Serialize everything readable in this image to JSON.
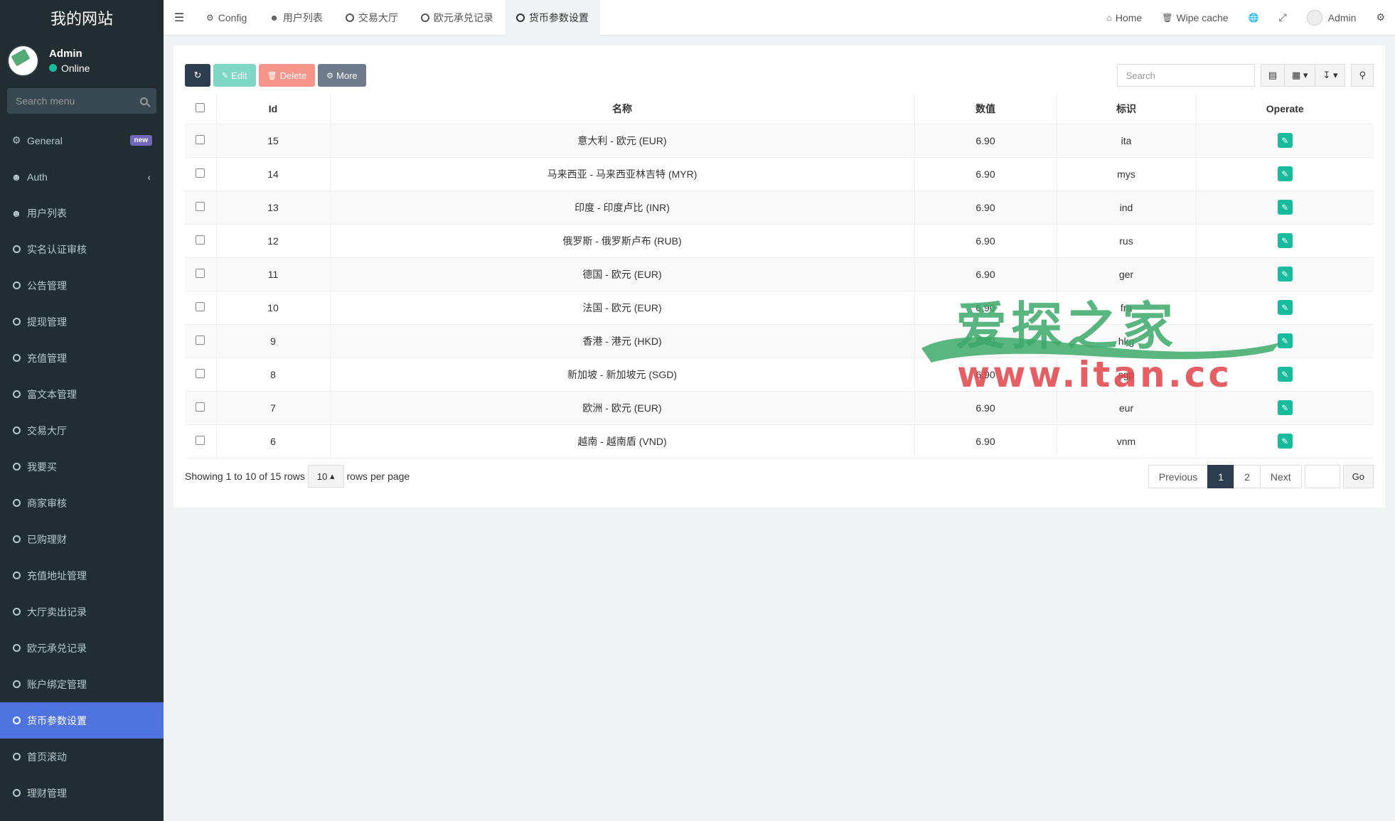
{
  "sidebar": {
    "logo": "我的网站",
    "user": {
      "name": "Admin",
      "status": "Online"
    },
    "search_placeholder": "Search menu",
    "badge_new": "new",
    "items": [
      {
        "label": "General",
        "icon": "cogs-icon"
      },
      {
        "label": "Auth",
        "icon": "users-icon"
      },
      {
        "label": "用户列表",
        "icon": "user-icon"
      },
      {
        "label": "实名认证审核",
        "icon": "circle-icon"
      },
      {
        "label": "公告管理",
        "icon": "circle-icon"
      },
      {
        "label": "提现管理",
        "icon": "circle-icon"
      },
      {
        "label": "充值管理",
        "icon": "circle-icon"
      },
      {
        "label": "富文本管理",
        "icon": "circle-icon"
      },
      {
        "label": "交易大厅",
        "icon": "circle-icon"
      },
      {
        "label": "我要买",
        "icon": "circle-icon"
      },
      {
        "label": "商家审核",
        "icon": "circle-icon"
      },
      {
        "label": "已购理财",
        "icon": "circle-icon"
      },
      {
        "label": "充值地址管理",
        "icon": "circle-icon"
      },
      {
        "label": "大厅卖出记录",
        "icon": "circle-icon"
      },
      {
        "label": "欧元承兑记录",
        "icon": "circle-icon"
      },
      {
        "label": "账户绑定管理",
        "icon": "circle-icon"
      },
      {
        "label": "货币参数设置",
        "icon": "circle-icon",
        "active": true
      },
      {
        "label": "首页滚动",
        "icon": "circle-icon"
      },
      {
        "label": "理财管理",
        "icon": "circle-icon"
      }
    ]
  },
  "topbar": {
    "tabs": [
      {
        "label": "Config",
        "icon": "gear-icon"
      },
      {
        "label": "用户列表",
        "icon": "user-icon"
      },
      {
        "label": "交易大厅",
        "icon": "circle-icon"
      },
      {
        "label": "欧元承兑记录",
        "icon": "circle-icon"
      },
      {
        "label": "货币参数设置",
        "icon": "circle-icon",
        "active": true
      }
    ],
    "home_label": "Home",
    "wipe_label": "Wipe cache",
    "admin_label": "Admin"
  },
  "toolbar": {
    "edit_label": "Edit",
    "delete_label": "Delete",
    "more_label": "More",
    "search_placeholder": "Search"
  },
  "table": {
    "headers": {
      "id": "Id",
      "name": "名称",
      "value": "数值",
      "tag": "标识",
      "operate": "Operate"
    },
    "rows": [
      {
        "id": "15",
        "name": "意大利 - 欧元 (EUR)",
        "value": "6.90",
        "tag": "ita"
      },
      {
        "id": "14",
        "name": "马来西亚 - 马来西亚林吉特 (MYR)",
        "value": "6.90",
        "tag": "mys"
      },
      {
        "id": "13",
        "name": "印度 - 印度卢比 (INR)",
        "value": "6.90",
        "tag": "ind"
      },
      {
        "id": "12",
        "name": "俄罗斯 - 俄罗斯卢布 (RUB)",
        "value": "6.90",
        "tag": "rus"
      },
      {
        "id": "11",
        "name": "德国 - 欧元 (EUR)",
        "value": "6.90",
        "tag": "ger"
      },
      {
        "id": "10",
        "name": "法国 - 欧元 (EUR)",
        "value": "6.90",
        "tag": "fra"
      },
      {
        "id": "9",
        "name": "香港 - 港元 (HKD)",
        "value": "6.90",
        "tag": "hkg"
      },
      {
        "id": "8",
        "name": "新加坡 - 新加坡元 (SGD)",
        "value": "6.90",
        "tag": "sgp"
      },
      {
        "id": "7",
        "name": "欧洲 - 欧元 (EUR)",
        "value": "6.90",
        "tag": "eur"
      },
      {
        "id": "6",
        "name": "越南 - 越南盾 (VND)",
        "value": "6.90",
        "tag": "vnm"
      }
    ]
  },
  "pagination": {
    "info": "Showing 1 to 10 of 15 rows",
    "page_size": "10",
    "rows_per_page": "rows per page",
    "previous": "Previous",
    "pages": [
      "1",
      "2"
    ],
    "next": "Next",
    "go": "Go"
  },
  "watermark": {
    "text": "爱探之家",
    "url": "www.itan.cc"
  },
  "colors": {
    "sidebar_bg": "#222d32",
    "active_menu": "#4e73df",
    "success": "#18bc9c",
    "primary_dark": "#2c3e50"
  }
}
